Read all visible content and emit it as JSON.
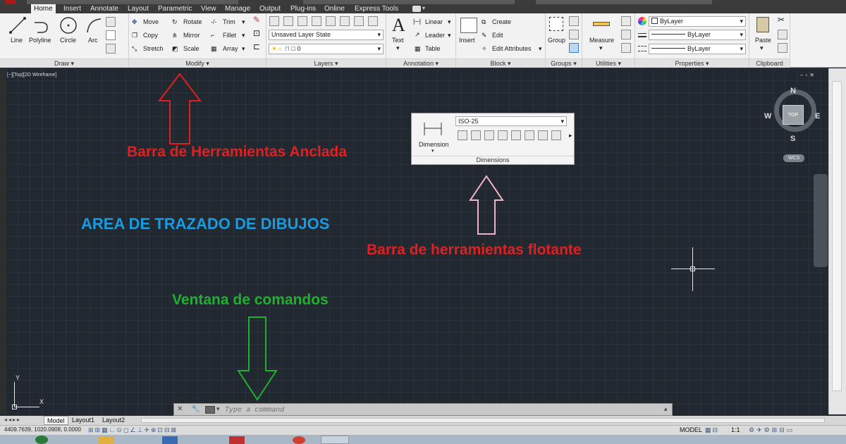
{
  "tabs": [
    "Home",
    "Insert",
    "Annotate",
    "Layout",
    "Parametric",
    "View",
    "Manage",
    "Output",
    "Plug-ins",
    "Online",
    "Express Tools"
  ],
  "draw": {
    "line": "Line",
    "polyline": "Polyline",
    "circle": "Circle",
    "arc": "Arc",
    "title": "Draw"
  },
  "modify": {
    "move": "Move",
    "rotate": "Rotate",
    "trim": "Trim",
    "copy": "Copy",
    "mirror": "Mirror",
    "fillet": "Fillet",
    "stretch": "Stretch",
    "scale": "Scale",
    "array": "Array",
    "title": "Modify"
  },
  "layers": {
    "layer_state": "Unsaved Layer State",
    "layer_value": "0",
    "title": "Layers"
  },
  "annotation": {
    "text": "Text",
    "linear": "Linear",
    "leader": "Leader",
    "table": "Table",
    "title": "Annotation"
  },
  "block": {
    "insert": "Insert",
    "create": "Create",
    "edit": "Edit",
    "edit_attributes": "Edit Attributes",
    "title": "Block"
  },
  "groups": {
    "group": "Group",
    "title": "Groups"
  },
  "utilities": {
    "measure": "Measure",
    "title": "Utilities"
  },
  "properties": {
    "color": "ByLayer",
    "linetype": "ByLayer",
    "lineweight": "ByLayer",
    "title": "Properties"
  },
  "clipboard": {
    "paste": "Paste",
    "title": "Clipboard"
  },
  "viewport_label": "[−][Top][2D Wireframe]",
  "viewcube": {
    "n": "N",
    "s": "S",
    "e": "E",
    "w": "W",
    "top": "TOP",
    "wcs": "WCS"
  },
  "annotations": {
    "docked": "Barra de Herramientas Anclada",
    "drawing_area": "AREA DE TRAZADO DE DIBUJOS",
    "floating": "Barra de herramientas flotante",
    "command_window": "Ventana de comandos"
  },
  "floating_toolbar": {
    "style": "ISO-25",
    "dimension": "Dimension",
    "title": "Dimensions"
  },
  "command": {
    "placeholder": "Type a command"
  },
  "layout_tabs": [
    "Model",
    "Layout1",
    "Layout2"
  ],
  "status": {
    "coords": "4409.7639, 1020.0908, 0.0000",
    "model": "MODEL",
    "scale": "1:1"
  },
  "colors": {
    "docked_arrow": "#e02020",
    "floating_arrow": "#f0b4c8",
    "command_arrow": "#20b030",
    "area_text": "#1a9be0"
  }
}
